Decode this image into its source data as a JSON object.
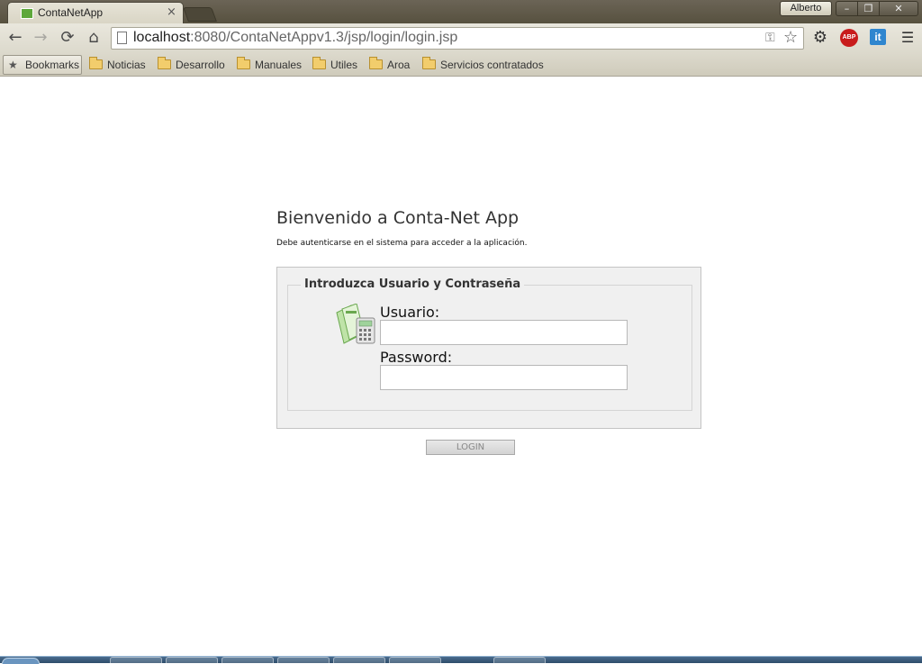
{
  "browser": {
    "tab": {
      "title": "ContaNetApp",
      "close": "×"
    },
    "user": "Alberto",
    "window_controls": {
      "minimize": "–",
      "maximize": "❐",
      "close": "✕"
    },
    "nav": {
      "back": "←",
      "forward": "→",
      "reload": "⟳",
      "home": "⌂"
    },
    "url": {
      "host": "localhost",
      "rest": ":8080/ContaNetAppv1.3/jsp/login/login.jsp"
    },
    "extensions": {
      "abp": "ABP",
      "it": "it"
    }
  },
  "bookmarks": {
    "label": "Bookmarks",
    "items": [
      "Noticias",
      "Desarrollo",
      "Manuales",
      "Utiles",
      "Aroa",
      "Servicios contratados"
    ]
  },
  "page": {
    "title": "Bienvenido a Conta-Net App",
    "subtitle": "Debe autenticarse en el sistema para acceder a la aplicación.",
    "form": {
      "legend": "Introduzca Usuario y Contraseña",
      "user_label": "Usuario:",
      "user_value": "",
      "password_label": "Password:",
      "password_value": "",
      "submit_label": "LOGIN"
    }
  },
  "colors": {
    "abp_red": "#c81c1c",
    "it_blue": "#2f86cf",
    "panel_bg": "#f0f0f0"
  }
}
